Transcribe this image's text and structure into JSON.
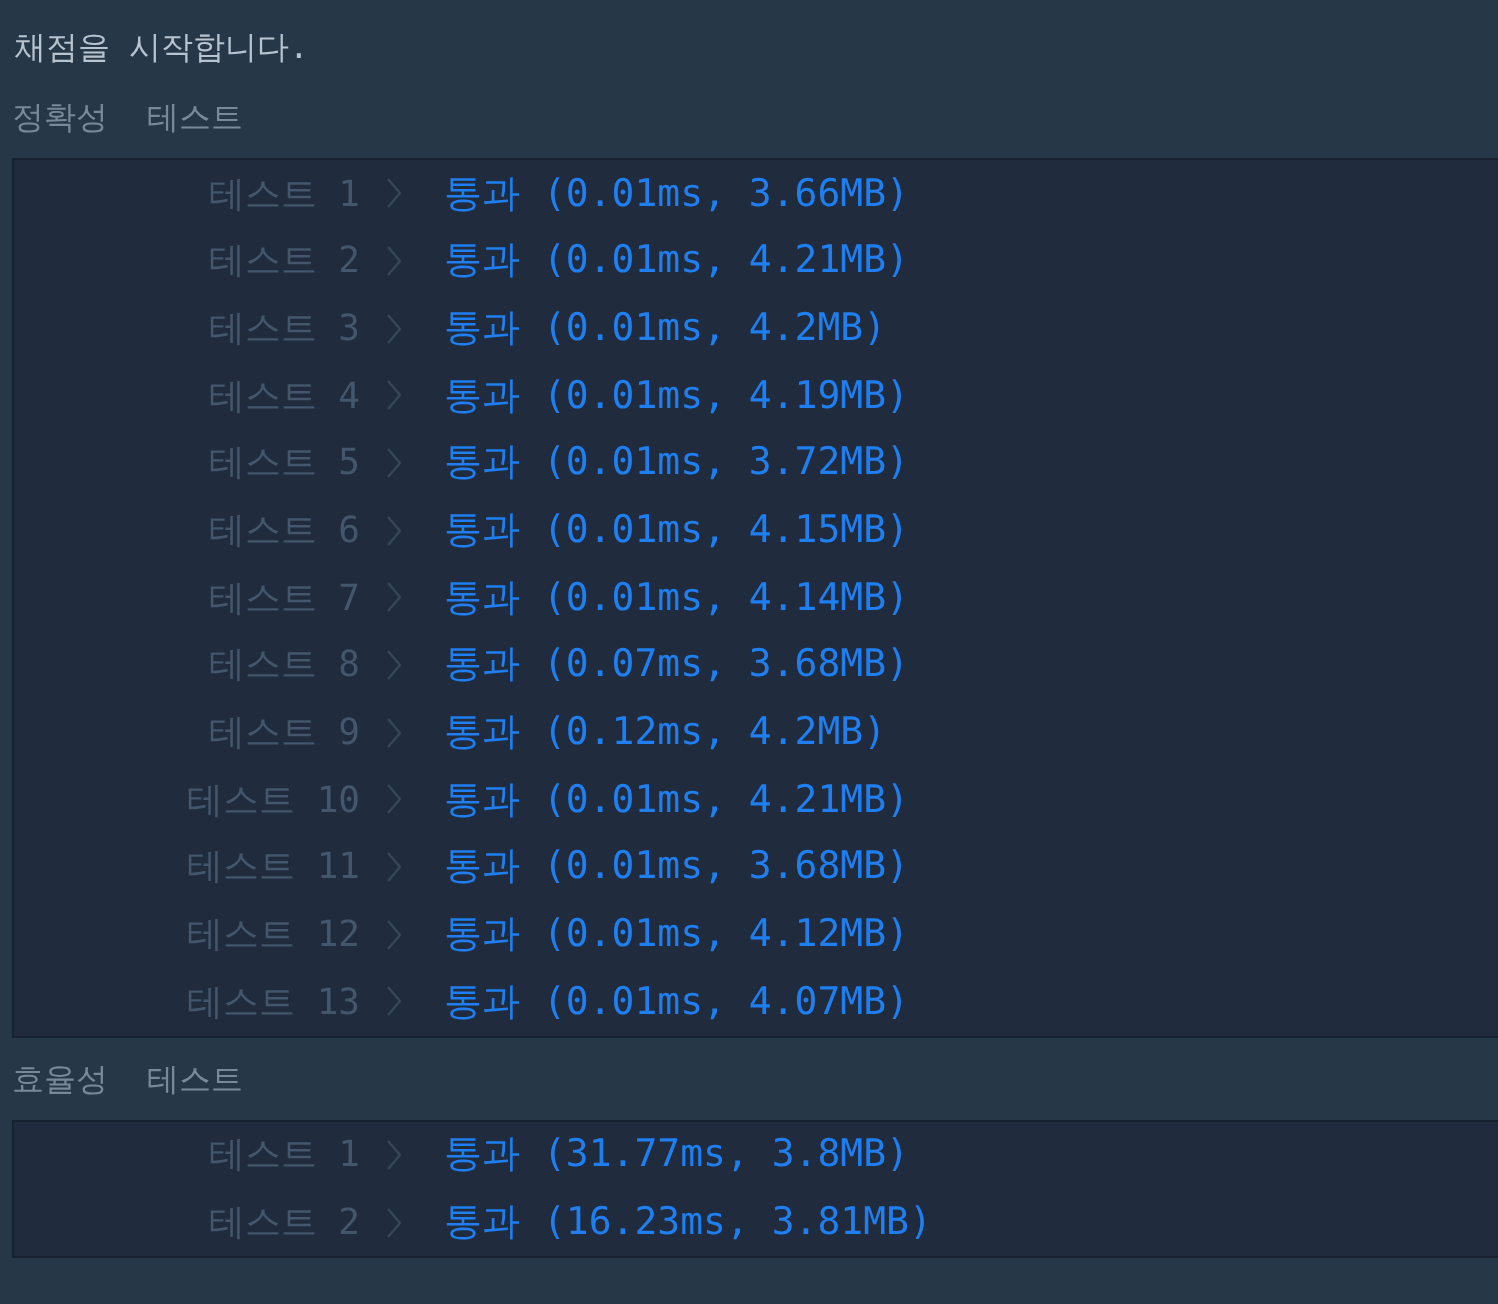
{
  "header": {
    "message": "채점을 시작합니다."
  },
  "sections": [
    {
      "title": "정확성  테스트",
      "tests": [
        {
          "label": "테스트 1",
          "result": "통과 (0.01ms, 3.66MB)"
        },
        {
          "label": "테스트 2",
          "result": "통과 (0.01ms, 4.21MB)"
        },
        {
          "label": "테스트 3",
          "result": "통과 (0.01ms, 4.2MB)"
        },
        {
          "label": "테스트 4",
          "result": "통과 (0.01ms, 4.19MB)"
        },
        {
          "label": "테스트 5",
          "result": "통과 (0.01ms, 3.72MB)"
        },
        {
          "label": "테스트 6",
          "result": "통과 (0.01ms, 4.15MB)"
        },
        {
          "label": "테스트 7",
          "result": "통과 (0.01ms, 4.14MB)"
        },
        {
          "label": "테스트 8",
          "result": "통과 (0.07ms, 3.68MB)"
        },
        {
          "label": "테스트 9",
          "result": "통과 (0.12ms, 4.2MB)"
        },
        {
          "label": "테스트 10",
          "result": "통과 (0.01ms, 4.21MB)"
        },
        {
          "label": "테스트 11",
          "result": "통과 (0.01ms, 3.68MB)"
        },
        {
          "label": "테스트 12",
          "result": "통과 (0.01ms, 4.12MB)"
        },
        {
          "label": "테스트 13",
          "result": "통과 (0.01ms, 4.07MB)"
        }
      ]
    },
    {
      "title": "효율성  테스트",
      "tests": [
        {
          "label": "테스트 1",
          "result": "통과 (31.77ms, 3.8MB)"
        },
        {
          "label": "테스트 2",
          "result": "통과 (16.23ms, 3.81MB)"
        }
      ]
    }
  ]
}
